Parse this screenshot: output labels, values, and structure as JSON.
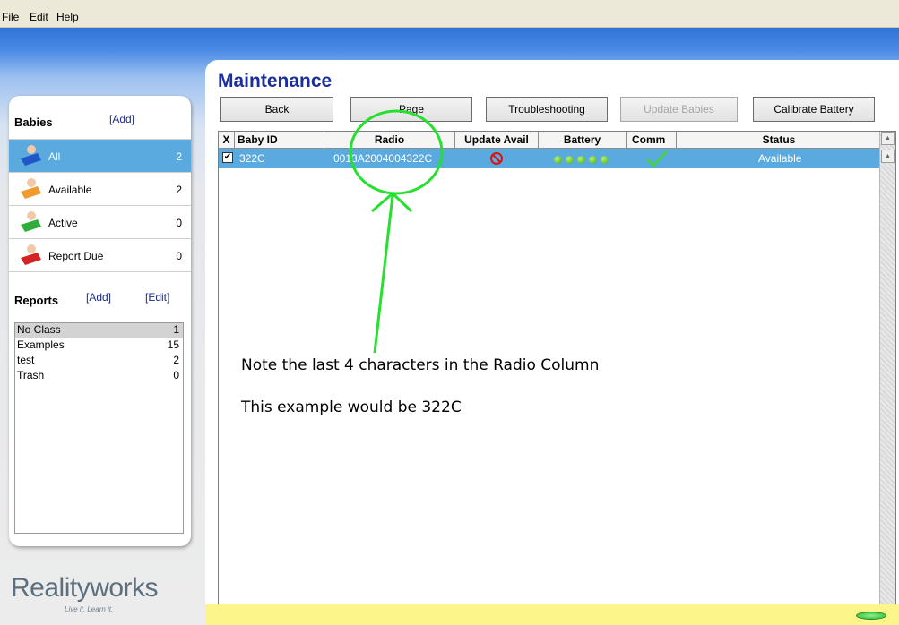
{
  "menu": {
    "file": "File",
    "edit": "Edit",
    "help": "Help"
  },
  "babies": {
    "title": "Babies",
    "add_link": "[Add]",
    "items": [
      {
        "label": "All",
        "count": "2",
        "icon_color": "#1f57c9"
      },
      {
        "label": "Available",
        "count": "2",
        "icon_color": "#f29a2e"
      },
      {
        "label": "Active",
        "count": "0",
        "icon_color": "#2fae3c"
      },
      {
        "label": "Report Due",
        "count": "0",
        "icon_color": "#d42323"
      }
    ]
  },
  "reports": {
    "title": "Reports",
    "add_link": "[Add]",
    "edit_link": "[Edit]",
    "items": [
      {
        "label": "No Class",
        "count": "1"
      },
      {
        "label": "Examples",
        "count": "15"
      },
      {
        "label": "test",
        "count": "2"
      },
      {
        "label": "Trash",
        "count": "0"
      }
    ]
  },
  "logo": {
    "main": "Realityworks",
    "tagline": "Live it. Learn it."
  },
  "main": {
    "title": "Maintenance",
    "buttons": {
      "back": "Back",
      "page": "Page",
      "troubleshooting": "Troubleshooting",
      "update_babies": "Update Babies",
      "calibrate_battery": "Calibrate Battery"
    },
    "columns": {
      "x": "X",
      "baby_id": "Baby ID",
      "radio": "Radio",
      "update_avail": "Update Avail",
      "battery": "Battery",
      "comm": "Comm",
      "status": "Status"
    },
    "row": {
      "checked": true,
      "baby_id": "322C",
      "radio": "0013A2004004322C",
      "battery_level": 5,
      "status": "Available"
    }
  },
  "annotation": {
    "line1": "Note the last 4 characters in the Radio Column",
    "line2": "This example would be 322C",
    "color": "#26e02f"
  }
}
